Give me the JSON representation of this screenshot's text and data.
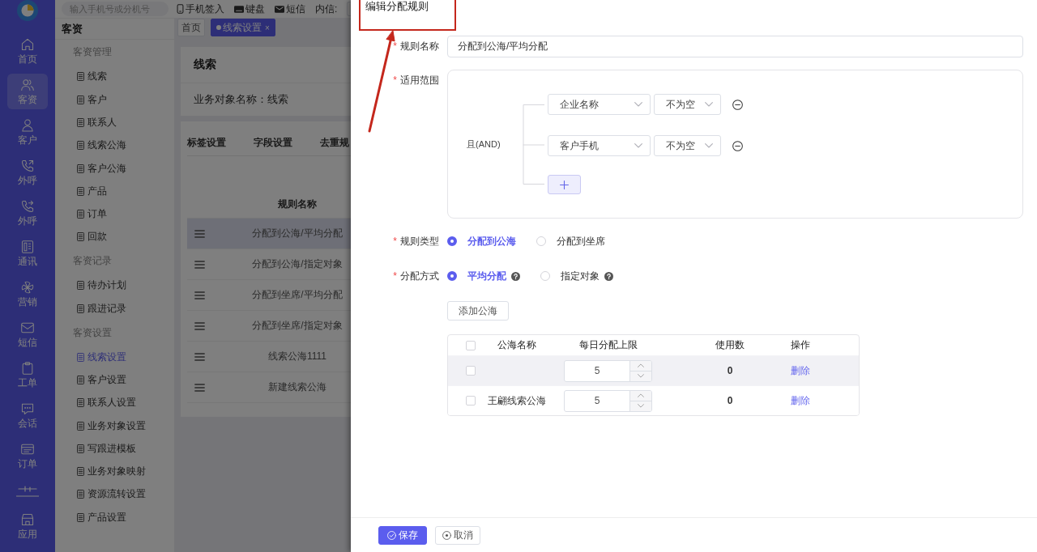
{
  "topbar": {
    "search": {
      "placeholder": "输入手机号或分机号"
    },
    "actions": [
      {
        "label": "手机签入"
      },
      {
        "label": "键盘"
      },
      {
        "label": "短信"
      }
    ],
    "inbox": {
      "label": "内信:"
    }
  },
  "nav_rail": {
    "items": [
      {
        "label": "首页",
        "selected": false
      },
      {
        "label": "客资",
        "selected": true
      },
      {
        "label": "客户",
        "selected": false
      },
      {
        "label": "外呼",
        "selected": false
      },
      {
        "label": "外呼",
        "selected": false
      },
      {
        "label": "通讯",
        "selected": false
      },
      {
        "label": "营销",
        "selected": false
      },
      {
        "label": "短信",
        "selected": false
      },
      {
        "label": "工单",
        "selected": false
      },
      {
        "label": "会话",
        "selected": false
      },
      {
        "label": "订单",
        "selected": false
      }
    ],
    "bottom_item": {
      "label": "应用"
    }
  },
  "menu": {
    "title": "客资",
    "groups": [
      {
        "title": "客资管理",
        "items": [
          {
            "label": "线索",
            "selected": false
          },
          {
            "label": "客户",
            "selected": false
          },
          {
            "label": "联系人",
            "selected": false
          },
          {
            "label": "线索公海",
            "selected": false
          },
          {
            "label": "客户公海",
            "selected": false
          },
          {
            "label": "产品",
            "selected": false
          },
          {
            "label": "订单",
            "selected": false
          },
          {
            "label": "回款",
            "selected": false
          }
        ]
      },
      {
        "title": "客资记录",
        "items": [
          {
            "label": "待办计划",
            "selected": false
          },
          {
            "label": "跟进记录",
            "selected": false
          }
        ]
      },
      {
        "title": "客资设置",
        "items": [
          {
            "label": "线索设置",
            "selected": true
          },
          {
            "label": "客户设置",
            "selected": false
          },
          {
            "label": "联系人设置",
            "selected": false
          },
          {
            "label": "业务对象设置",
            "selected": false
          },
          {
            "label": "写跟进模板",
            "selected": false
          },
          {
            "label": "业务对象映射",
            "selected": false
          },
          {
            "label": "资源流转设置",
            "selected": false
          },
          {
            "label": "产品设置",
            "selected": false
          }
        ]
      }
    ]
  },
  "page_tabs": [
    {
      "label": "首页",
      "selected": false
    },
    {
      "label": "线索设置",
      "selected": true,
      "close": "×"
    }
  ],
  "object_card": {
    "title": "线索",
    "object_name": "业务对象名称：线索"
  },
  "settings_tabs": [
    {
      "label": "标签设置"
    },
    {
      "label": "字段设置"
    },
    {
      "label": "去重规"
    }
  ],
  "rules_table": {
    "columns": [
      "规则名称"
    ],
    "rows": [
      {
        "name": "分配到公海/平均分配",
        "selected": true
      },
      {
        "name": "分配到公海/指定对象",
        "selected": false
      },
      {
        "name": "分配到坐席/平均分配",
        "selected": false
      },
      {
        "name": "分配到坐席/指定对象",
        "selected": false
      },
      {
        "name": "线索公海1111",
        "selected": false
      },
      {
        "name": "新建线索公海",
        "selected": false
      }
    ]
  },
  "drawer": {
    "title": "编辑分配规则",
    "required_mark": "*",
    "rule_name": {
      "label": "规则名称",
      "required": true,
      "value": "分配到公海/平均分配"
    },
    "scope": {
      "label": "适用范围",
      "required": true,
      "logic": "且(AND)",
      "conditions": [
        {
          "field": "企业名称",
          "operator": "不为空"
        },
        {
          "field": "客户手机",
          "operator": "不为空"
        }
      ]
    },
    "rule_type": {
      "label": "规则类型",
      "required": true,
      "options": [
        {
          "label": "分配到公海",
          "selected": true,
          "help": false
        },
        {
          "label": "分配到坐席",
          "selected": false,
          "help": false
        }
      ]
    },
    "method": {
      "label": "分配方式",
      "required": true,
      "options": [
        {
          "label": "平均分配",
          "selected": true,
          "help": true
        },
        {
          "label": "指定对象",
          "selected": false,
          "help": true
        }
      ]
    },
    "add_pool_button": "添加公海",
    "pool_table": {
      "columns": [
        "公海名称",
        "每日分配上限",
        "使用数",
        "操作"
      ],
      "all_checked": false,
      "rows": [
        {
          "checked": false,
          "highlighted": true,
          "limit": "5",
          "used": "0",
          "action": "删除"
        },
        {
          "checked": false,
          "highlighted": false,
          "name": "王翩线索公海",
          "limit": "5",
          "used": "0",
          "action": "删除"
        }
      ]
    },
    "buttons": [
      {
        "label": "保存",
        "kind": "primary"
      },
      {
        "label": "取消",
        "kind": "default"
      }
    ]
  }
}
